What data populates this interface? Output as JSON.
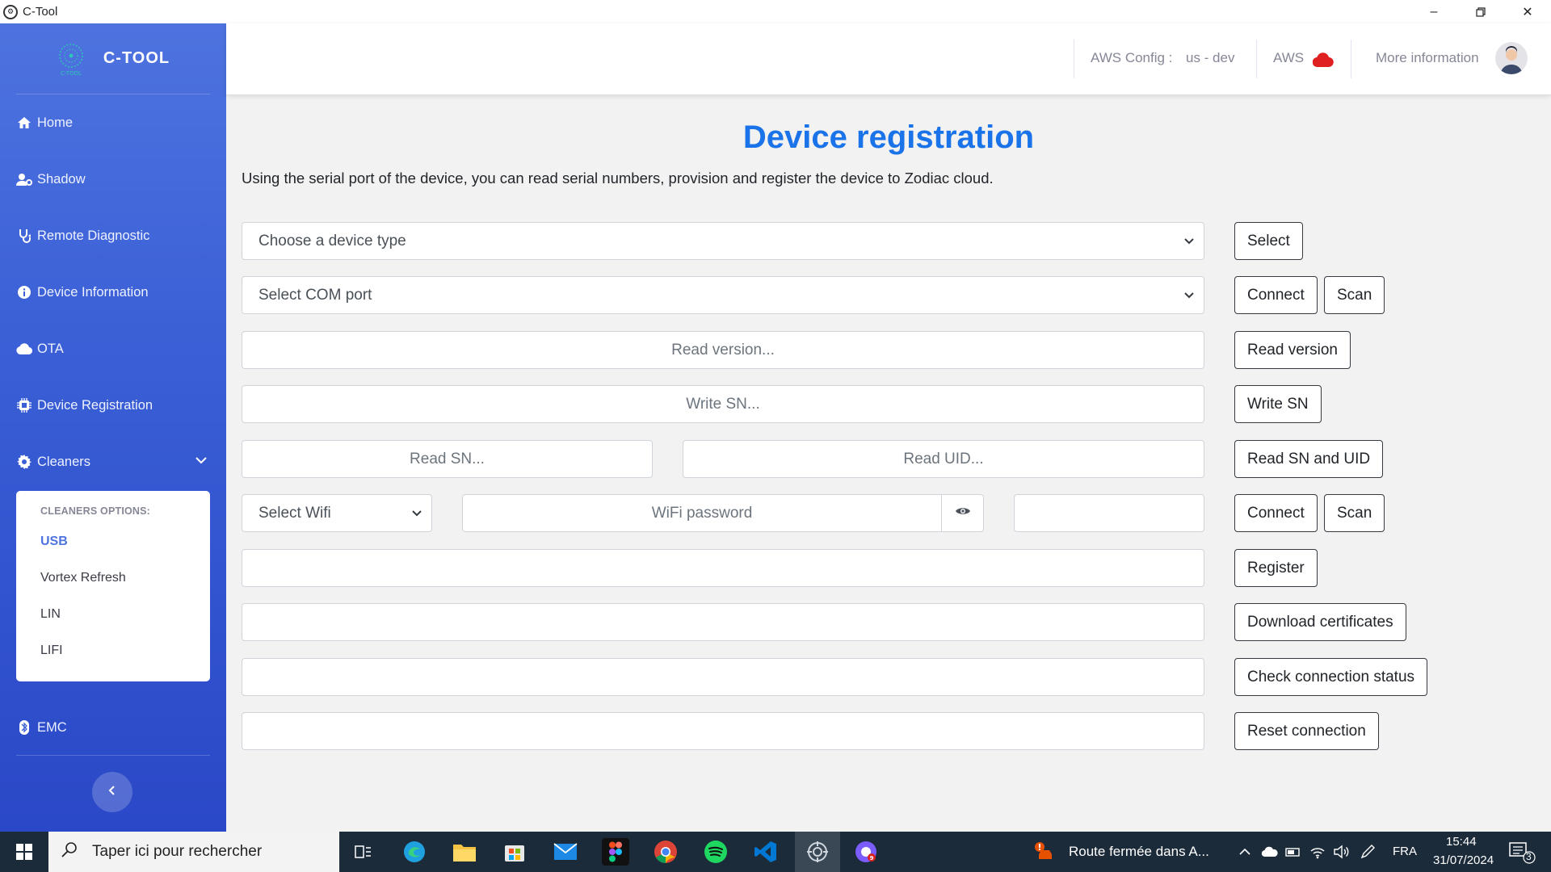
{
  "window": {
    "title": "C-Tool",
    "controls": [
      "minimize-icon",
      "restore-icon",
      "close-icon"
    ]
  },
  "sidebar": {
    "brand": {
      "name": "C-TOOL",
      "logo_text": "C-TOOL"
    },
    "items": [
      {
        "label": "Home",
        "icon": "home-icon"
      },
      {
        "label": "Shadow",
        "icon": "user-gear-icon"
      },
      {
        "label": "Remote Diagnostic",
        "icon": "stethoscope-icon"
      },
      {
        "label": "Device Information",
        "icon": "info-circle-icon"
      },
      {
        "label": "OTA",
        "icon": "cloud-icon"
      },
      {
        "label": "Device Registration",
        "icon": "chip-icon"
      },
      {
        "label": "Cleaners",
        "icon": "gear-icon",
        "expanded": true
      },
      {
        "label": "EMC",
        "icon": "bluetooth-icon"
      }
    ],
    "cleaners_menu": {
      "header": "CLEANERS OPTIONS:",
      "items": [
        "USB",
        "Vortex Refresh",
        "LIN",
        "LIFI"
      ],
      "active": "USB"
    }
  },
  "topbar": {
    "aws_config_label": "AWS Config :",
    "aws_config_value": "us - dev",
    "aws_label": "AWS",
    "aws_status_color": "#e02020",
    "more_info": "More information"
  },
  "main": {
    "title": "Device registration",
    "description": "Using the serial port of the device, you can read serial numbers, provision and register the device to Zodiac cloud.",
    "device_type_select": "Choose a device type",
    "com_port_select": "Select COM port",
    "read_version_placeholder": "Read version...",
    "write_sn_placeholder": "Write SN...",
    "read_sn_placeholder": "Read SN...",
    "read_uid_placeholder": "Read UID...",
    "wifi_select": "Select Wifi",
    "wifi_password_placeholder": "WiFi password",
    "buttons": {
      "select": "Select",
      "connect": "Connect",
      "scan": "Scan",
      "read_version": "Read version",
      "write_sn": "Write SN",
      "read_sn_uid": "Read SN and UID",
      "wifi_connect": "Connect",
      "wifi_scan": "Scan",
      "register": "Register",
      "download_certificates": "Download certificates",
      "check_connection": "Check connection status",
      "reset_connection": "Reset connection"
    }
  },
  "taskbar": {
    "search_placeholder": "Taper ici pour rechercher",
    "notification_text": "Route fermée dans A...",
    "language": "FRA",
    "time": "15:44",
    "date": "31/07/2024",
    "notification_count": "3",
    "app_icons": [
      "task-view-icon",
      "edge-icon",
      "file-explorer-icon",
      "store-icon",
      "mail-icon",
      "figma-icon",
      "chrome-icon",
      "spotify-icon",
      "vscode-icon",
      "ctool-icon",
      "chat-icon"
    ]
  },
  "colors": {
    "sidebar_top": "#4e73df",
    "sidebar_bottom": "#2a48c7",
    "title_blue": "#1a73e8",
    "active_sub": "#4e73df"
  }
}
